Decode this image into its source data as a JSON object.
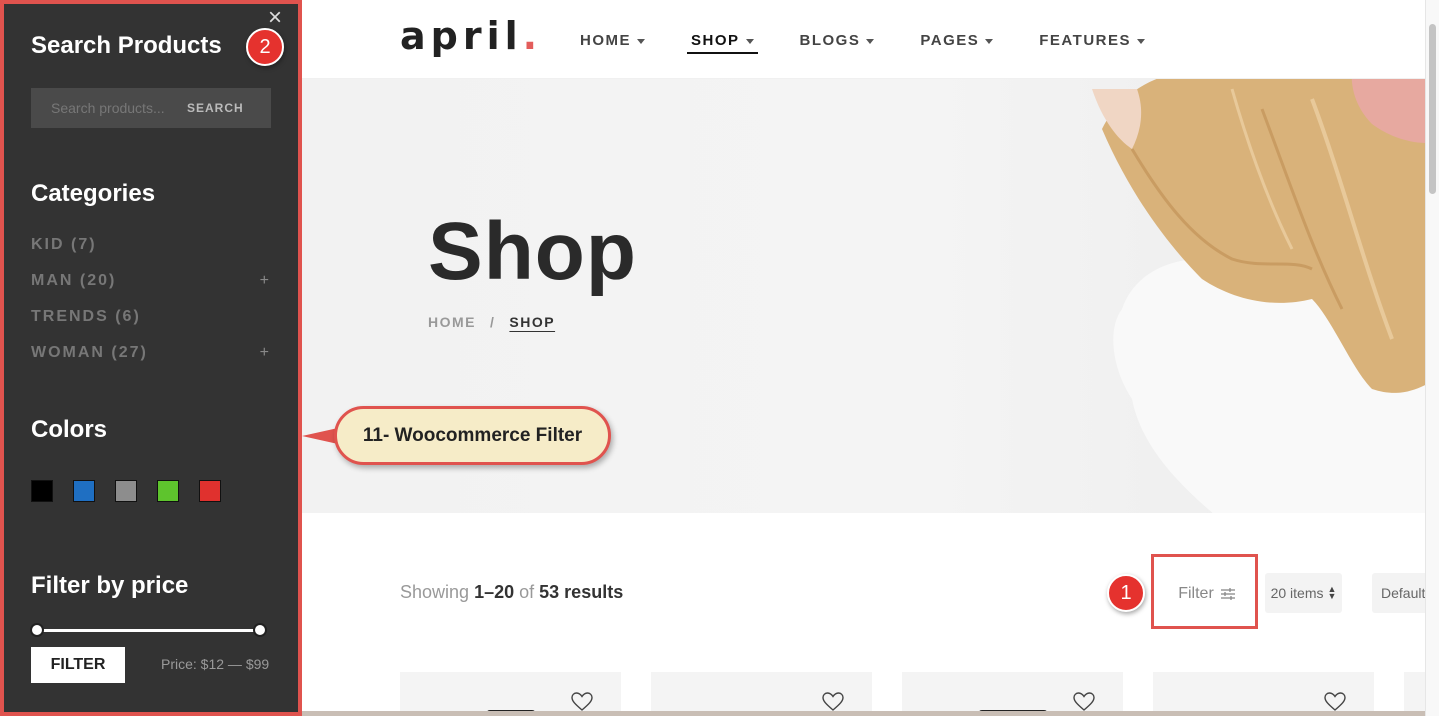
{
  "header": {
    "logo": "april",
    "logo_dot": ".",
    "nav": [
      {
        "label": "HOME",
        "active": false
      },
      {
        "label": "SHOP",
        "active": true
      },
      {
        "label": "BLOGS",
        "active": false
      },
      {
        "label": "PAGES",
        "active": false
      },
      {
        "label": "FEATURES",
        "active": false
      }
    ]
  },
  "hero": {
    "title": "Shop",
    "breadcrumb": {
      "home": "HOME",
      "sep": "/",
      "current": "SHOP"
    }
  },
  "toolbar": {
    "showing_prefix": "Showing",
    "showing_range": "1–20",
    "showing_of": "of",
    "showing_count": "53 results",
    "filter_label": "Filter",
    "items_label": "20 items",
    "sort_label": "Default sorting"
  },
  "sidebar": {
    "close_icon": "×",
    "search_heading": "Search Products",
    "search_placeholder": "Search products...",
    "search_button": "SEARCH",
    "categories_heading": "Categories",
    "categories": [
      {
        "label": "KID (7)",
        "expandable": false
      },
      {
        "label": "MAN (20)",
        "expandable": true
      },
      {
        "label": "TRENDS (6)",
        "expandable": false
      },
      {
        "label": "WOMAN (27)",
        "expandable": true
      }
    ],
    "expand_symbol": "+",
    "colors_heading": "Colors",
    "colors": [
      "#000000",
      "#1f6fc2",
      "#8d8d8d",
      "#5ec42d",
      "#e0312e"
    ],
    "price_heading": "Filter by price",
    "filter_button": "FILTER",
    "price_text": "Price: $12 — $99"
  },
  "annotations": {
    "badge_1": "1",
    "badge_2": "2",
    "callout": "11- Woocommerce Filter",
    "accent": "#e0534e"
  }
}
